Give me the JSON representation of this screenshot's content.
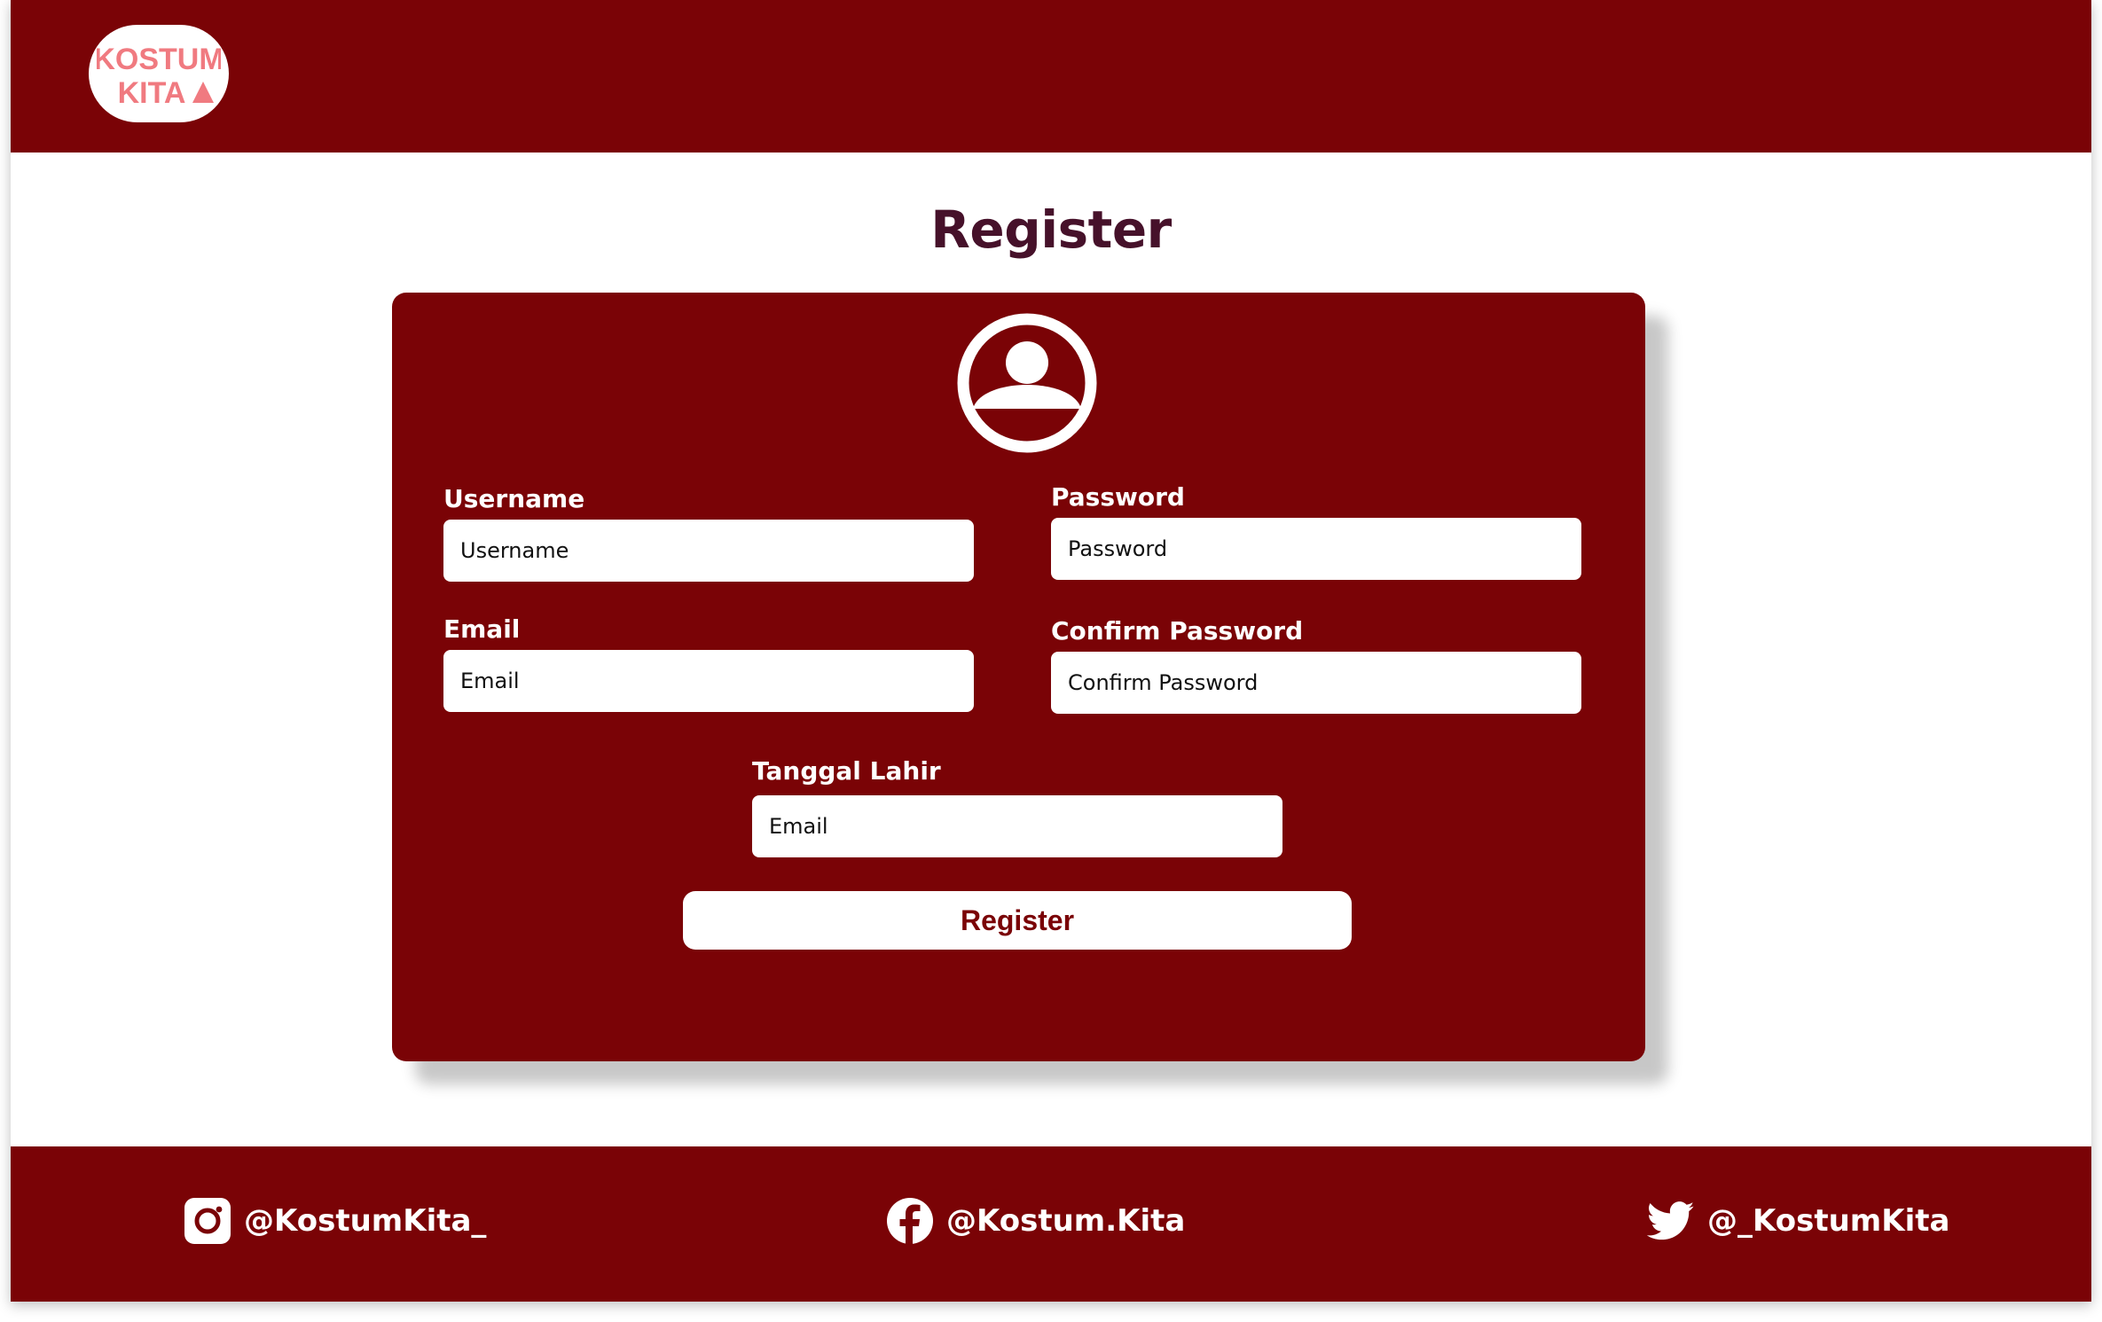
{
  "header": {
    "logo_alt": "Kostum Kita logo",
    "logo_line1": "KOSTUM",
    "logo_line2": "KITA"
  },
  "page": {
    "title": "Register"
  },
  "form": {
    "avatar_icon": "user-circle-icon",
    "username": {
      "label": "Username",
      "placeholder": "Username",
      "value": ""
    },
    "password": {
      "label": "Password",
      "placeholder": "Password",
      "value": ""
    },
    "email": {
      "label": "Email",
      "placeholder": "Email",
      "value": ""
    },
    "confirm_password": {
      "label": "Confirm Password",
      "placeholder": "Confirm Password",
      "value": ""
    },
    "birth_date": {
      "label": "Tanggal Lahir",
      "placeholder": "Email",
      "value": ""
    },
    "submit_label": "Register"
  },
  "footer": {
    "instagram": {
      "icon": "instagram-icon",
      "handle": "@KostumKita_"
    },
    "facebook": {
      "icon": "facebook-icon",
      "handle": "@Kostum.Kita"
    },
    "twitter": {
      "icon": "twitter-icon",
      "handle": "@_KostumKita"
    }
  },
  "colors": {
    "brand": "#7a0306",
    "title": "#46112a",
    "logo_accent": "#f07a80",
    "background": "#ffffff"
  }
}
